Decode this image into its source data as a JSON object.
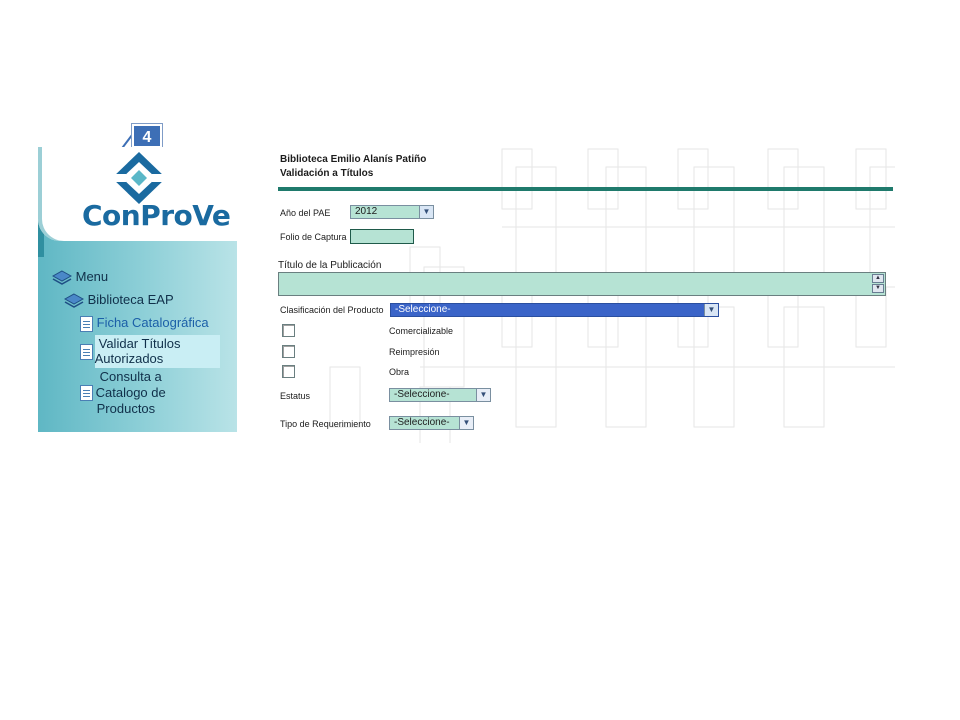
{
  "callout": {
    "number": "4"
  },
  "sidebar": {
    "logo_text": "ConProVe",
    "menu_title": "Menu",
    "group": "Biblioteca EAP",
    "items": [
      {
        "label": "Ficha Catalográfica"
      },
      {
        "label_line1": "Validar Títulos",
        "label_line2": "Autorizados"
      },
      {
        "label_line1": "Consulta a",
        "label_line2": "Catalogo de",
        "label_line3": "Productos"
      }
    ]
  },
  "header": {
    "title": "Biblioteca Emilio Alanís Patiño",
    "subtitle": "Validación a Títulos"
  },
  "form": {
    "anio_label": "Año del PAE",
    "anio_value": "2012",
    "folio_label": "Folio de Captura",
    "folio_value": "",
    "titulo_label": "Título de la Publicación",
    "titulo_value": "",
    "clasificacion_label": "Clasificación del Producto",
    "clasificacion_value": "-Seleccione-",
    "checkboxes": [
      {
        "label": "Comercializable",
        "checked": false
      },
      {
        "label": "Reimpresión",
        "checked": false
      },
      {
        "label": "Obra",
        "checked": false
      }
    ],
    "estatus_label": "Estatus",
    "estatus_value": "-Seleccione-",
    "tipo_label": "Tipo de Requerimiento",
    "tipo_value": "-Seleccione-"
  },
  "colors": {
    "accent_teal": "#1f7a6c",
    "field_green": "#b6e3d4",
    "highlight_blue": "#3a64c8",
    "logo_blue": "#1a6aa0"
  },
  "icons": {
    "chevron": "chevron-down-icon",
    "doc": "document-icon",
    "layers": "layers-icon"
  }
}
